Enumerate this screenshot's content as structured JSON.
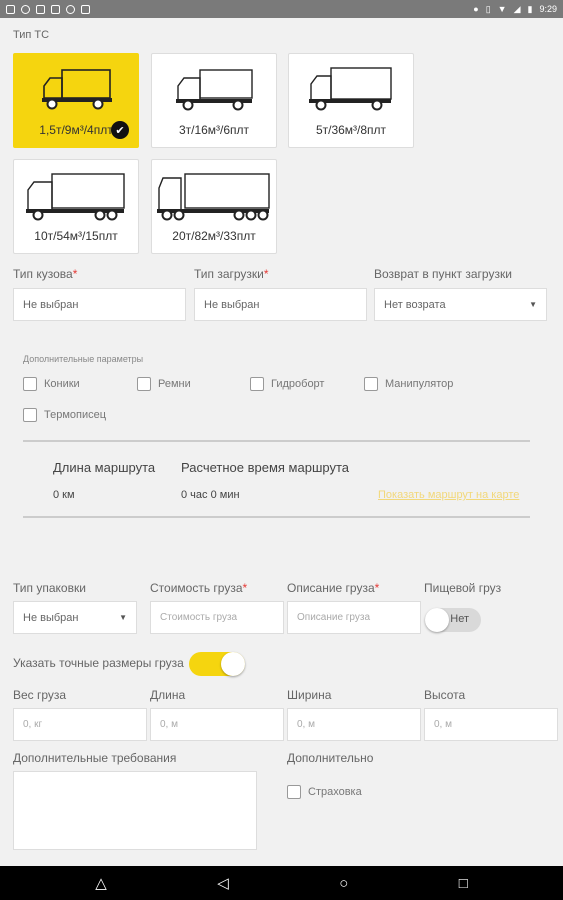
{
  "status_bar": {
    "time": "9:29"
  },
  "vehicle_type_label": "Тип ТС",
  "vehicles": [
    {
      "caption": "1,5т/9м³/4плт",
      "selected": true
    },
    {
      "caption": "3т/16м³/6плт",
      "selected": false
    },
    {
      "caption": "5т/36м³/8плт",
      "selected": false
    },
    {
      "caption": "10т/54м³/15плт",
      "selected": false
    },
    {
      "caption": "20т/82м³/33плт",
      "selected": false
    }
  ],
  "body_type": {
    "label": "Тип кузова",
    "value": "Не выбран"
  },
  "loading_type": {
    "label": "Тип загрузки",
    "value": "Не выбран"
  },
  "return_point": {
    "label": "Возврат в пункт загрузки",
    "value": "Нет возрата"
  },
  "extra_params": {
    "label": "Дополнительные параметры",
    "options": [
      "Коники",
      "Ремни",
      "Гидроборт",
      "Манипулятор",
      "Термописец"
    ]
  },
  "route": {
    "length_label": "Длина маршрута",
    "length_value": "0 км",
    "time_label": "Расчетное время маршрута",
    "time_value": "0 час 0 мин",
    "map_link": "Показать маршрут на карте"
  },
  "packaging": {
    "label": "Тип упаковки",
    "value": "Не выбран"
  },
  "cargo_cost": {
    "label": "Стоимость груза",
    "placeholder": "Стоимость груза"
  },
  "cargo_desc": {
    "label": "Описание груза",
    "placeholder": "Описание груза"
  },
  "food_cargo": {
    "label": "Пищевой груз",
    "toggle_text": "Нет"
  },
  "exact_dims": {
    "label": "Указать точные размеры груза"
  },
  "weight": {
    "label": "Вес груза",
    "placeholder": "0, кг"
  },
  "length": {
    "label": "Длина",
    "placeholder": "0, м"
  },
  "width": {
    "label": "Ширина",
    "placeholder": "0, м"
  },
  "height": {
    "label": "Высота",
    "placeholder": "0, м"
  },
  "extra_requirements": {
    "label": "Дополнительные требования"
  },
  "additional": {
    "label": "Дополнительно",
    "insurance": "Страховка"
  },
  "colors": {
    "accent": "#f5d50f",
    "required": "#e53935",
    "link": "#f2d87a"
  }
}
